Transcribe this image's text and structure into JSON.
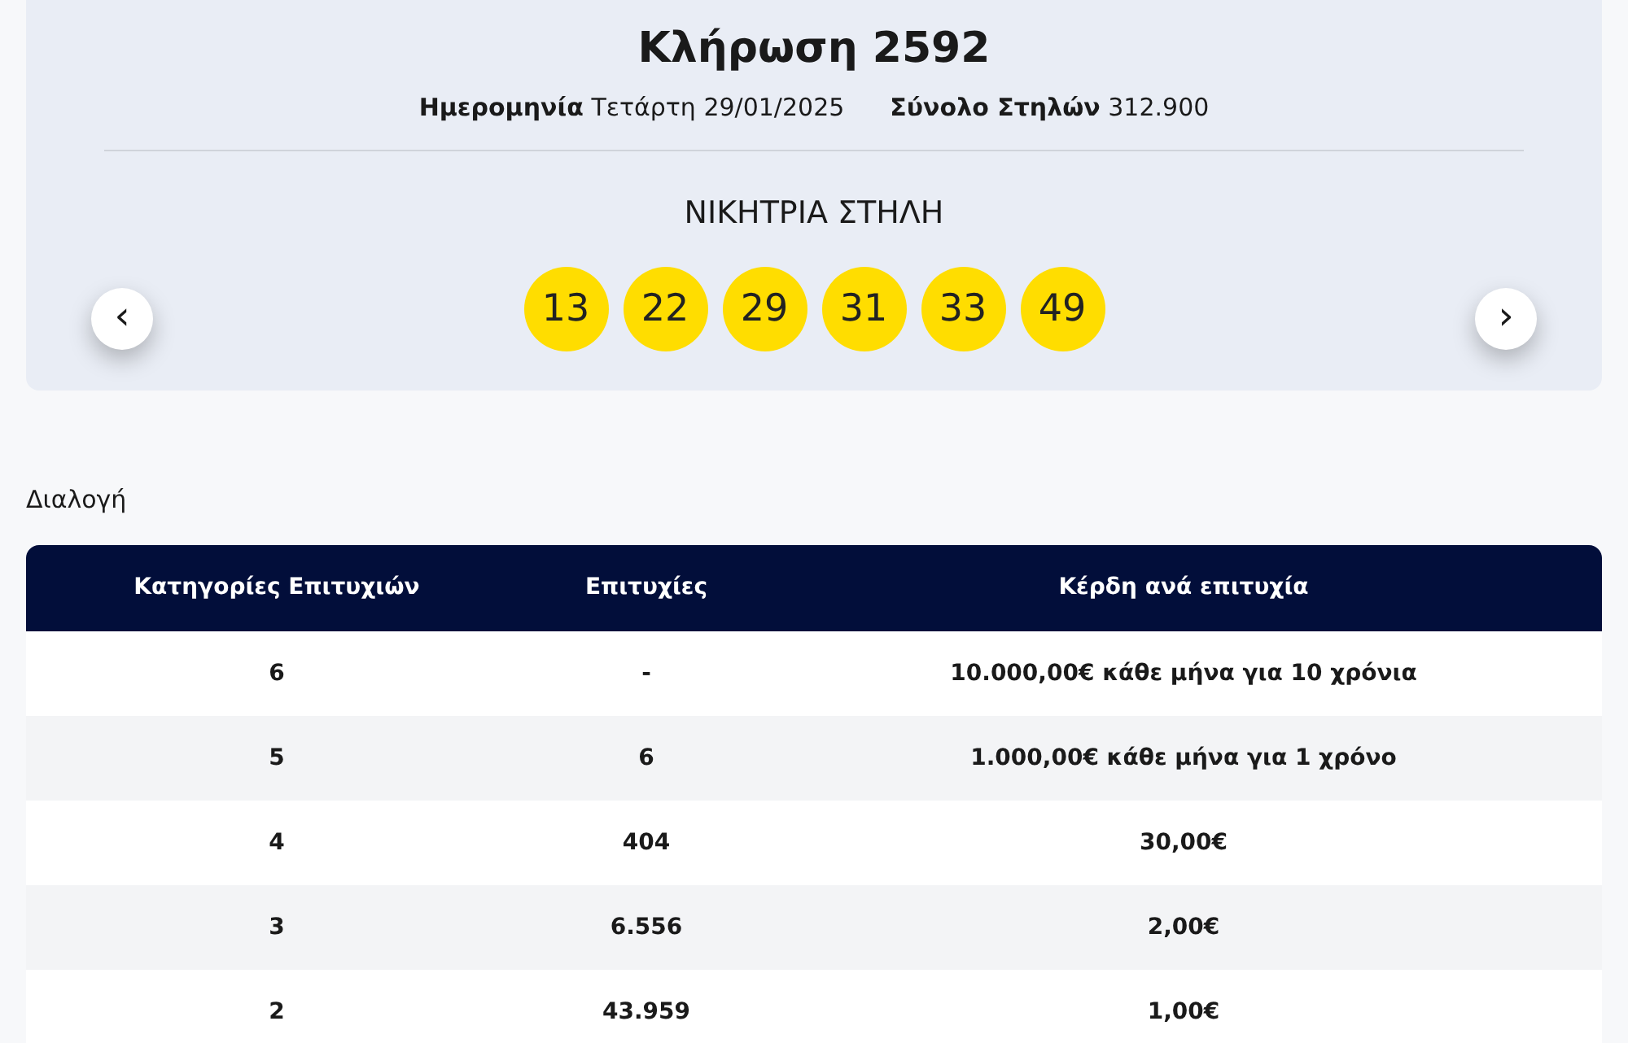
{
  "draw": {
    "title": "Κλήρωση 2592",
    "date_label": "Ημερομηνία",
    "date_value": "Τετάρτη 29/01/2025",
    "total_label": "Σύνολο Στηλών",
    "total_value": "312.900",
    "winning_heading": "ΝΙΚΗΤΡΙΑ ΣΤΗΛΗ",
    "numbers": [
      "13",
      "22",
      "29",
      "31",
      "33",
      "49"
    ],
    "prev": "‹",
    "next": "›"
  },
  "section_title": "Διαλογή",
  "table": {
    "columns": [
      "Κατηγορίες Επιτυχιών",
      "Επιτυχίες",
      "Κέρδη ανά επιτυχία"
    ],
    "rows": [
      [
        "6",
        "-",
        "10.000,00€ κάθε μήνα για 10 χρόνια"
      ],
      [
        "5",
        "6",
        "1.000,00€ κάθε μήνα για 1 χρόνο"
      ],
      [
        "4",
        "404",
        "30,00€"
      ],
      [
        "3",
        "6.556",
        "2,00€"
      ],
      [
        "2",
        "43.959",
        "1,00€"
      ]
    ]
  }
}
